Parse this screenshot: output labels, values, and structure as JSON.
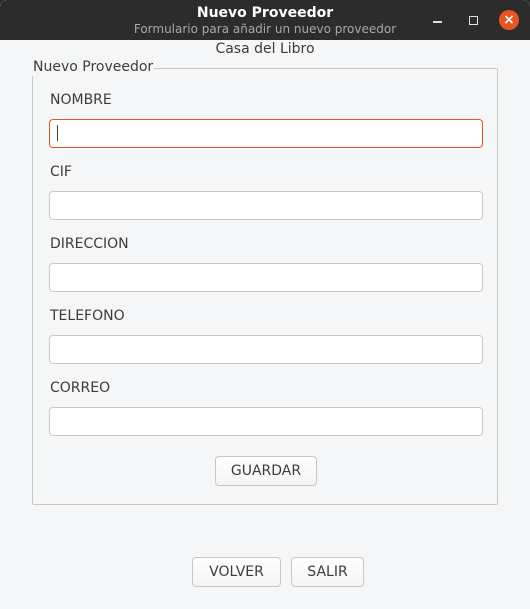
{
  "window": {
    "title": "Nuevo Proveedor",
    "subtitle": "Formulario para añadir un nuevo proveedor",
    "close_glyph": "×"
  },
  "app": {
    "title": "Casa del Libro"
  },
  "group": {
    "title": "Nuevo Proveedor"
  },
  "fields": {
    "nombre": {
      "label": "NOMBRE",
      "value": ""
    },
    "cif": {
      "label": "CIF",
      "value": ""
    },
    "direccion": {
      "label": "DIRECCION",
      "value": ""
    },
    "telefono": {
      "label": "TELEFONO",
      "value": ""
    },
    "correo": {
      "label": "CORREO",
      "value": ""
    }
  },
  "buttons": {
    "guardar": "GUARDAR",
    "volver": "VOLVER",
    "salir": "SALIR"
  },
  "colors": {
    "accent": "#e95420",
    "titlebar": "#2c2c2c",
    "background": "#f5f6f7"
  },
  "icons": {
    "minimize": "minimize-icon",
    "maximize": "maximize-icon",
    "close": "close-icon"
  }
}
